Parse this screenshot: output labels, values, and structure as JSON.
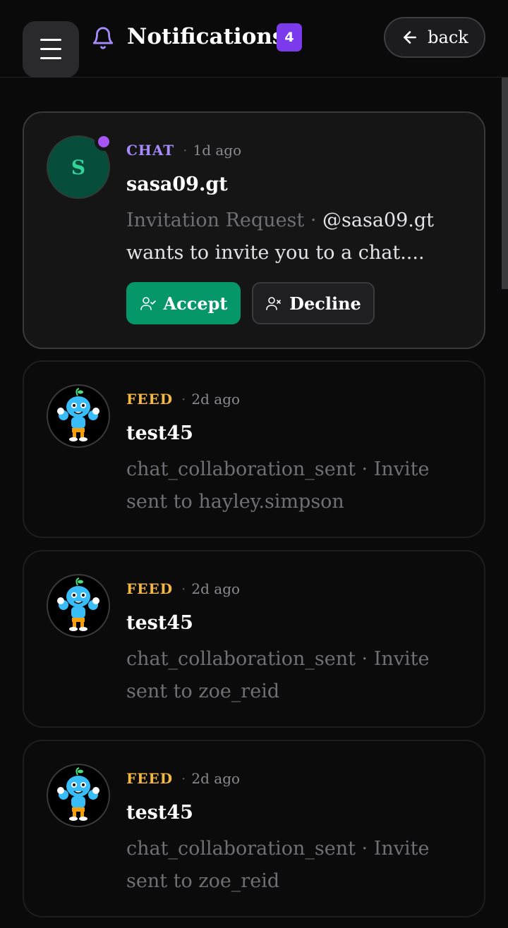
{
  "header": {
    "title": "Notifications",
    "badge_count": "4",
    "back_label": "back",
    "icons": [
      "menu-icon",
      "bell-icon",
      "arrow-left-icon"
    ]
  },
  "notifications": [
    {
      "category": "CHAT",
      "time": "1d ago",
      "name": "sasa09.gt",
      "avatar_letter": "S",
      "line1": "Invitation Request",
      "line1_sep": " · ",
      "handle": "@sasa09.gt",
      "line2": "wants to invite you to a chat....",
      "accept_label": "Accept",
      "decline_label": "Decline",
      "unread": true
    },
    {
      "category": "FEED",
      "time": "2d ago",
      "name": "test45",
      "text": "chat_collaboration_sent · Invite sent to hayley.simpson"
    },
    {
      "category": "FEED",
      "time": "2d ago",
      "name": "test45",
      "text": "chat_collaboration_sent · Invite sent to zoe_reid"
    },
    {
      "category": "FEED",
      "time": "2d ago",
      "name": "test45",
      "text": "chat_collaboration_sent · Invite sent to zoe_reid"
    }
  ],
  "colors": {
    "accent_purple": "#7c3aed",
    "chat_label": "#a78bfa",
    "feed_label": "#f5b942",
    "accept_green": "#059669"
  }
}
